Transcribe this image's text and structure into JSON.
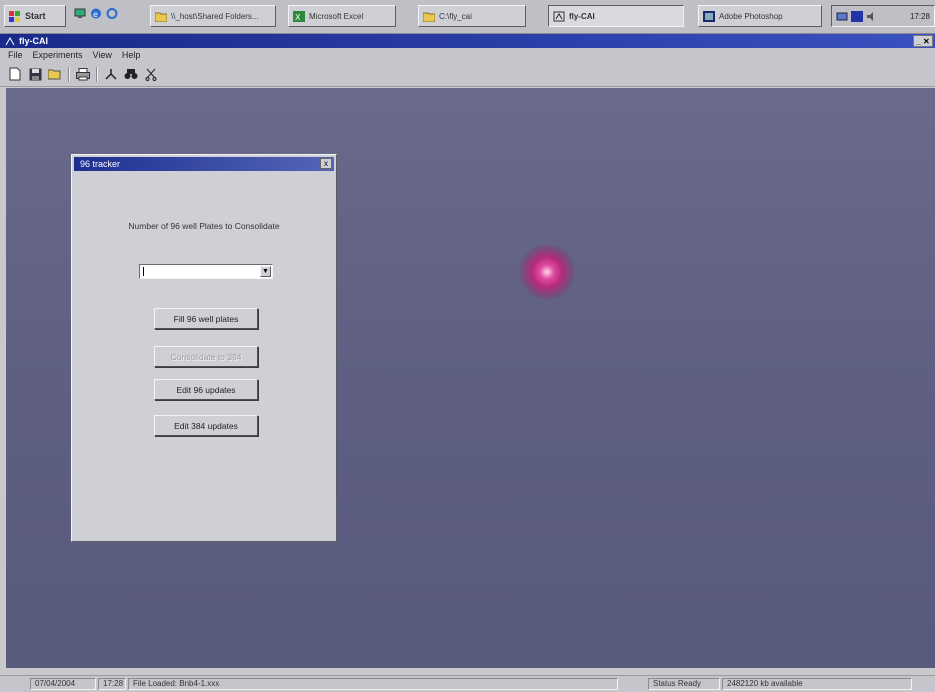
{
  "taskbar": {
    "start_label": "Start",
    "tasks": [
      {
        "label": "\\\\_host\\Shared Folders...",
        "active": false
      },
      {
        "label": "Microsoft Excel",
        "active": false
      },
      {
        "label": "C:\\fly_cai",
        "active": false
      },
      {
        "label": "fly-CAI",
        "active": true
      },
      {
        "label": "Adobe Photoshop",
        "active": false
      }
    ],
    "clock": "17:28"
  },
  "window": {
    "title": "fly-CAI",
    "controls": "_ ✕"
  },
  "menu": [
    "File",
    "Experiments",
    "View",
    "Help"
  ],
  "toolbar_icons": [
    "new-file-icon",
    "save-icon",
    "open-icon",
    "print-icon",
    "tree-icon",
    "binoculars-icon",
    "cut-icon"
  ],
  "dialog": {
    "title": "96 tracker",
    "close": "x",
    "prompt": "Number of 96 well Plates to Consolidate",
    "combo_value": "",
    "buttons": [
      {
        "label": "Fill 96 well plates",
        "enabled": true
      },
      {
        "label": "Consolidate to 384",
        "enabled": false
      },
      {
        "label": "Edit 96 updates",
        "enabled": true
      },
      {
        "label": "Edit 384 updates",
        "enabled": true
      }
    ]
  },
  "statusbar": {
    "date": "07/04/2004",
    "time": "17:28",
    "file": "File Loaded: Bnb4-1.xxx",
    "status": "Status Ready",
    "memory": "2482120 kb available"
  },
  "colors": {
    "client_background": "#5e5f82",
    "titlebar_start": "#1a2a8a",
    "marker": "#e04aa2"
  }
}
